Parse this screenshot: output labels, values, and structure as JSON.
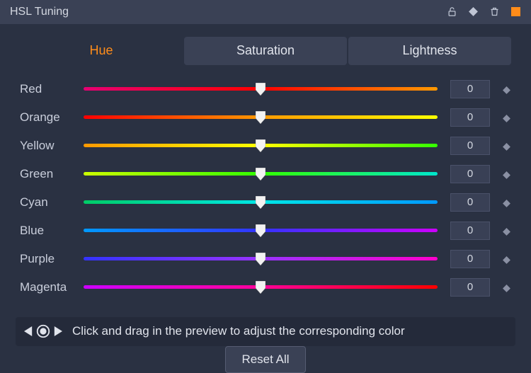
{
  "header": {
    "title": "HSL Tuning",
    "icons": {
      "lock": "unlock-icon",
      "diamond": "keyframe-icon",
      "trash": "trash-icon",
      "marker": "color-marker"
    }
  },
  "tabs": {
    "hue": "Hue",
    "saturation": "Saturation",
    "lightness": "Lightness",
    "active": "hue"
  },
  "rows": [
    {
      "id": "red",
      "label": "Red",
      "value": 0,
      "gradient": [
        "#e60073",
        "#ff0000",
        "#ff9900"
      ]
    },
    {
      "id": "orange",
      "label": "Orange",
      "value": 0,
      "gradient": [
        "#ff0000",
        "#ff9900",
        "#ffff00"
      ]
    },
    {
      "id": "yellow",
      "label": "Yellow",
      "value": 0,
      "gradient": [
        "#ff9900",
        "#ffff00",
        "#33ff00"
      ]
    },
    {
      "id": "green",
      "label": "Green",
      "value": 0,
      "gradient": [
        "#ccff00",
        "#33ff00",
        "#00e6cc"
      ]
    },
    {
      "id": "cyan",
      "label": "Cyan",
      "value": 0,
      "gradient": [
        "#00cc66",
        "#00e6e6",
        "#0099ff"
      ]
    },
    {
      "id": "blue",
      "label": "Blue",
      "value": 0,
      "gradient": [
        "#0099ff",
        "#3333ff",
        "#cc00ff"
      ]
    },
    {
      "id": "purple",
      "label": "Purple",
      "value": 0,
      "gradient": [
        "#3333ff",
        "#9933ff",
        "#ff00cc"
      ]
    },
    {
      "id": "magenta",
      "label": "Magenta",
      "value": 0,
      "gradient": [
        "#cc00ff",
        "#ff0099",
        "#ff0000"
      ]
    }
  ],
  "hint": {
    "text": "Click and drag in the preview to adjust the corresponding color"
  },
  "footer": {
    "reset": "Reset All"
  }
}
